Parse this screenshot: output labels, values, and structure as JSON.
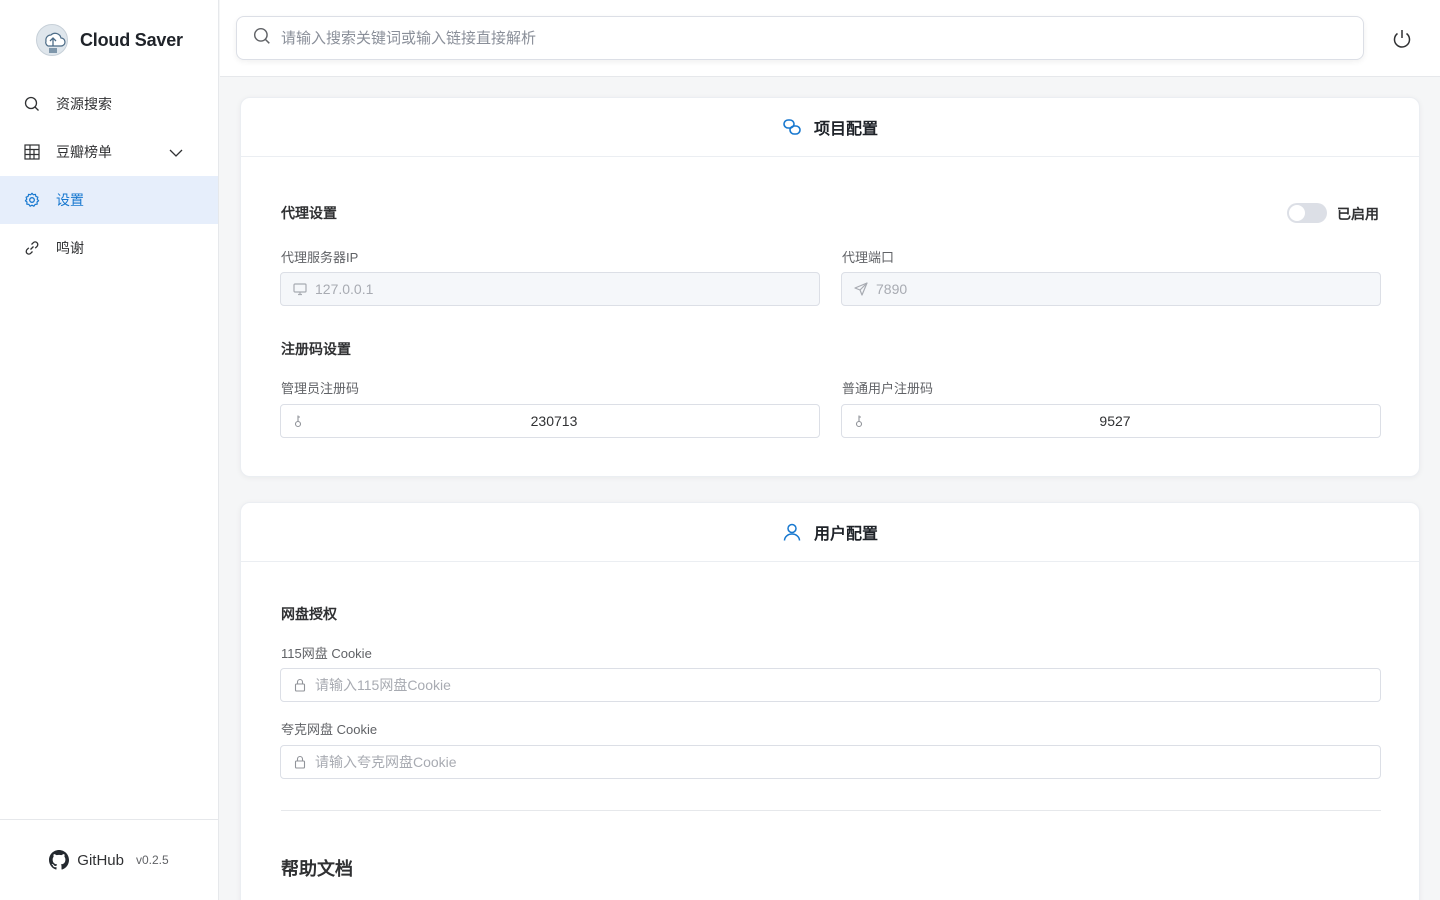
{
  "app": {
    "title": "Cloud Saver",
    "version": "v0.2.5",
    "github_label": "GitHub"
  },
  "sidebar": {
    "items": [
      {
        "label": "资源搜索",
        "icon": "search-icon"
      },
      {
        "label": "豆瓣榜单",
        "icon": "grid-icon"
      },
      {
        "label": "设置",
        "icon": "gear-icon",
        "active": true
      },
      {
        "label": "鸣谢",
        "icon": "link-icon"
      }
    ]
  },
  "search": {
    "placeholder": "请输入搜索关键词或输入链接直接解析"
  },
  "project_config": {
    "title": "项目配置",
    "proxy": {
      "section_title": "代理设置",
      "toggle_label": "已启用",
      "ip_label": "代理服务器IP",
      "ip_value": "127.0.0.1",
      "port_label": "代理端口",
      "port_value": "7890"
    },
    "register": {
      "section_title": "注册码设置",
      "admin_label": "管理员注册码",
      "admin_value": "230713",
      "user_label": "普通用户注册码",
      "user_value": "9527"
    }
  },
  "user_config": {
    "title": "用户配置",
    "netdisk": {
      "section_title": "网盘授权",
      "c115_label": "115网盘 Cookie",
      "c115_placeholder": "请输入115网盘Cookie",
      "quark_label": "夸克网盘 Cookie",
      "quark_placeholder": "请输入夸克网盘Cookie"
    },
    "help_title": "帮助文档"
  },
  "colors": {
    "accent": "#1677cf",
    "active_bg": "#e6eefb"
  }
}
